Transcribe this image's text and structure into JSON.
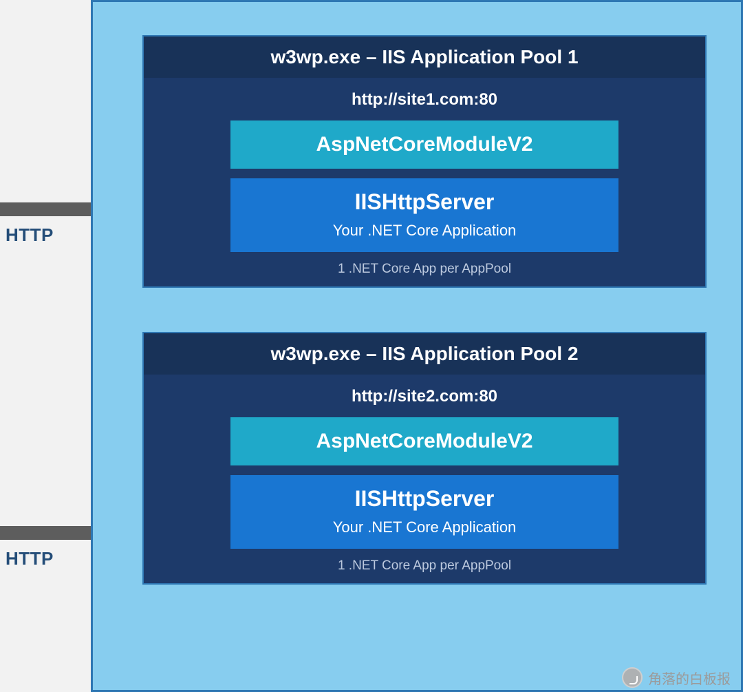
{
  "arrows": [
    {
      "label": "HTTP"
    },
    {
      "label": "HTTP"
    }
  ],
  "pools": [
    {
      "header": "w3wp.exe – IIS Application Pool 1",
      "url": "http://site1.com:80",
      "module": "AspNetCoreModuleV2",
      "server_title": "IISHttpServer",
      "server_sub": "Your .NET Core Application",
      "footer": "1 .NET Core App per AppPool"
    },
    {
      "header": "w3wp.exe – IIS Application Pool 2",
      "url": "http://site2.com:80",
      "module": "AspNetCoreModuleV2",
      "server_title": "IISHttpServer",
      "server_sub": "Your .NET Core Application",
      "footer": "1 .NET Core App per AppPool"
    }
  ],
  "watermark": "角落的白板报"
}
